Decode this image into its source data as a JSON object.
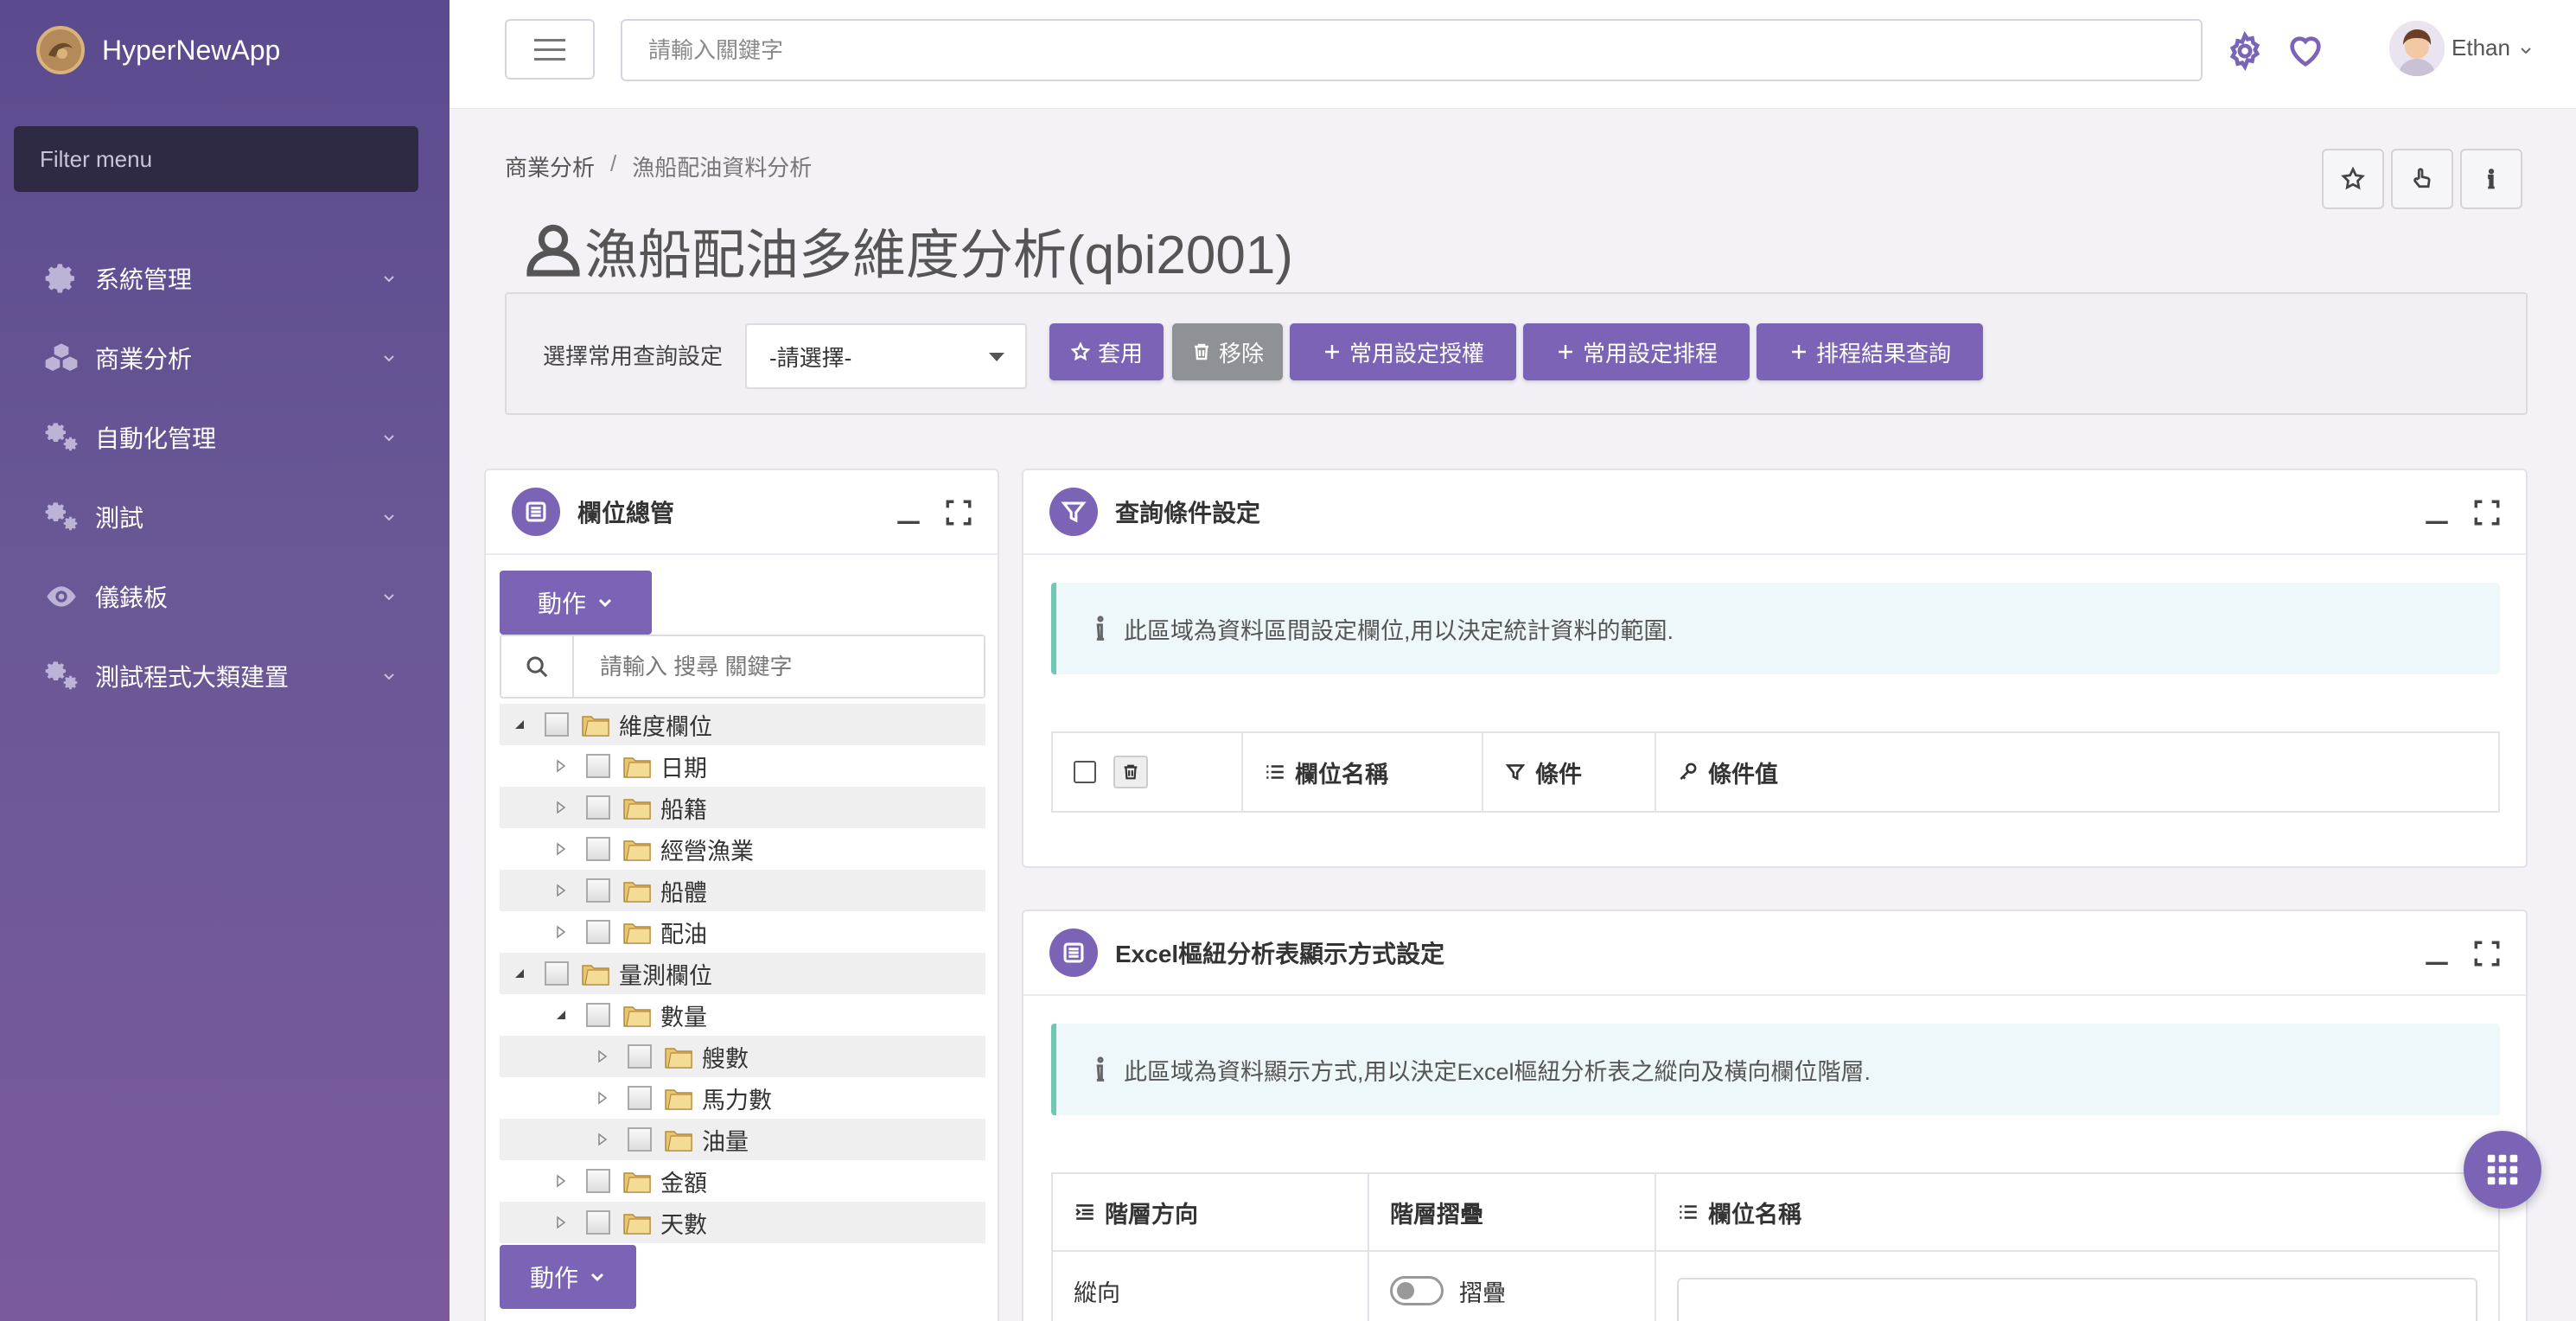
{
  "app": {
    "name": "HyperNewApp"
  },
  "sidebar": {
    "filter_placeholder": "Filter menu",
    "items": [
      {
        "label": "系統管理",
        "icon": "gear-icon"
      },
      {
        "label": "商業分析",
        "icon": "cubes-icon"
      },
      {
        "label": "自動化管理",
        "icon": "gears-icon"
      },
      {
        "label": "測試",
        "icon": "gears-icon"
      },
      {
        "label": "儀錶板",
        "icon": "eye-icon"
      },
      {
        "label": "測試程式大類建置",
        "icon": "gears-icon"
      }
    ]
  },
  "topbar": {
    "search_placeholder": "請輸入關鍵字",
    "user_name": "Ethan"
  },
  "breadcrumb": {
    "parent": "商業分析",
    "separator": "/",
    "current": "漁船配油資料分析"
  },
  "page": {
    "title": "漁船配油多維度分析(qbi2001)"
  },
  "query_bar": {
    "label": "選擇常用查詢設定",
    "select_value": "-請選擇-",
    "buttons": {
      "apply": "套用",
      "remove": "移除",
      "grant": "常用設定授權",
      "schedule": "常用設定排程",
      "schedule_result": "排程結果查詢"
    }
  },
  "field_panel": {
    "title": "欄位總管",
    "action_label": "動作",
    "search_placeholder": "請輸入 搜尋 關鍵字",
    "tree": [
      {
        "label": "維度欄位",
        "level": 0,
        "expanded": true
      },
      {
        "label": "日期",
        "level": 1,
        "expanded": false
      },
      {
        "label": "船籍",
        "level": 1,
        "expanded": false
      },
      {
        "label": "經營漁業",
        "level": 1,
        "expanded": false
      },
      {
        "label": "船體",
        "level": 1,
        "expanded": false
      },
      {
        "label": "配油",
        "level": 1,
        "expanded": false
      },
      {
        "label": "量測欄位",
        "level": 0,
        "expanded": true
      },
      {
        "label": "數量",
        "level": 1,
        "expanded": true
      },
      {
        "label": "艘數",
        "level": 2,
        "expanded": false
      },
      {
        "label": "馬力數",
        "level": 2,
        "expanded": false
      },
      {
        "label": "油量",
        "level": 2,
        "expanded": false
      },
      {
        "label": "金額",
        "level": 1,
        "expanded": false
      },
      {
        "label": "天數",
        "level": 1,
        "expanded": false
      }
    ]
  },
  "query_panel": {
    "title": "查詢條件設定",
    "info": "此區域為資料區間設定欄位,用以決定統計資料的範圍.",
    "columns": {
      "name": "欄位名稱",
      "condition": "條件",
      "value": "條件值"
    }
  },
  "excel_panel": {
    "title": "Excel樞紐分析表顯示方式設定",
    "info": "此區域為資料顯示方式,用以決定Excel樞紐分析表之縱向及橫向欄位階層.",
    "columns": {
      "direction": "階層方向",
      "collapse": "階層摺疊",
      "name": "欄位名稱"
    },
    "row": {
      "direction": "縱向",
      "collapse_label": "摺疊"
    }
  },
  "colors": {
    "accent": "#7b64b5",
    "sidebar": "#5b4a8e",
    "info_border": "#6fc7b4"
  }
}
